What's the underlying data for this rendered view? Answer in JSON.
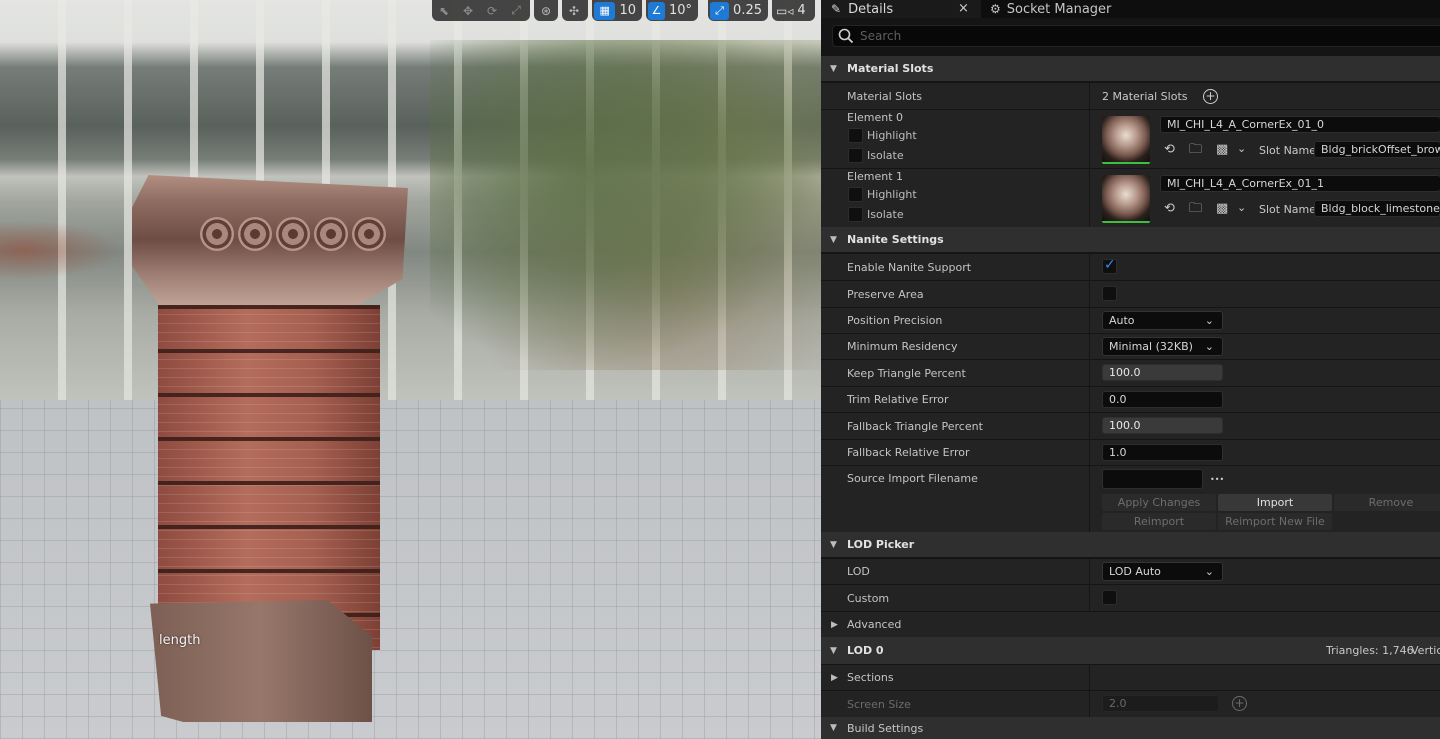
{
  "viewport": {
    "label": "length",
    "toolbar": {
      "grid_snap_value": "10",
      "rotate_snap_value": "10°",
      "scale_snap_value": "0.25",
      "camera_speed_value": "4"
    }
  },
  "tabs": {
    "details": "Details",
    "socket_manager": "Socket Manager",
    "close_glyph": "×"
  },
  "search": {
    "placeholder": "Search"
  },
  "material_slots": {
    "header": "Material Slots",
    "label": "Material Slots",
    "count_text": "2 Material Slots",
    "elements": [
      {
        "label": "Element 0",
        "highlight_label": "Highlight",
        "isolate_label": "Isolate",
        "material": "MI_CHI_L4_A_CornerEx_01_0",
        "slot_name_label": "Slot Name",
        "slot_name": "Bldg_brickOffset_brown"
      },
      {
        "label": "Element 1",
        "highlight_label": "Highlight",
        "isolate_label": "Isolate",
        "material": "MI_CHI_L4_A_CornerEx_01_1",
        "slot_name_label": "Slot Name",
        "slot_name": "Bldg_block_limestone_bro"
      }
    ]
  },
  "nanite": {
    "header": "Nanite Settings",
    "enable_label": "Enable Nanite Support",
    "enable_checked": true,
    "preserve_area_label": "Preserve Area",
    "preserve_area_checked": false,
    "position_precision_label": "Position Precision",
    "position_precision_value": "Auto",
    "minimum_residency_label": "Minimum Residency",
    "minimum_residency_value": "Minimal (32KB)",
    "keep_triangle_label": "Keep Triangle Percent",
    "keep_triangle_value": "100.0",
    "trim_error_label": "Trim Relative Error",
    "trim_error_value": "0.0",
    "fallback_triangle_label": "Fallback Triangle Percent",
    "fallback_triangle_value": "100.0",
    "fallback_error_label": "Fallback Relative Error",
    "fallback_error_value": "1.0",
    "source_import_label": "Source Import Filename",
    "source_import_value": "",
    "browse_glyph": "•••",
    "apply_changes": "Apply Changes",
    "import": "Import",
    "remove": "Remove",
    "reimport": "Reimport",
    "reimport_new_file": "Reimport New File"
  },
  "lod_picker": {
    "header": "LOD Picker",
    "lod_label": "LOD",
    "lod_value": "LOD Auto",
    "custom_label": "Custom",
    "custom_checked": false,
    "advanced_label": "Advanced"
  },
  "lod0": {
    "header": "LOD 0",
    "triangles": "Triangles: 1,746",
    "vertices_truncated": "Vertic",
    "sections_label": "Sections",
    "screen_size_label": "Screen Size",
    "screen_size_value": "2.0",
    "build_settings_label": "Build Settings"
  },
  "colors": {
    "accent_blue": "#1f7ad6",
    "check_blue": "#2f8ef0",
    "thumb_green": "#3fbf3f",
    "panel_bg": "#151515",
    "row_bg": "#232323",
    "category_bg": "#2f2f2f"
  },
  "icons": {
    "select": "select-icon",
    "translate": "translate-icon",
    "rotate": "rotate-icon",
    "scale": "scale-icon",
    "world_local": "world-local-icon",
    "surface_snap": "surface-snap-icon",
    "grid_snap": "grid-snap-icon",
    "rotate_snap": "rotate-snap-icon",
    "scale_snap": "scale-snap-icon",
    "camera_speed": "camera-speed-icon"
  }
}
